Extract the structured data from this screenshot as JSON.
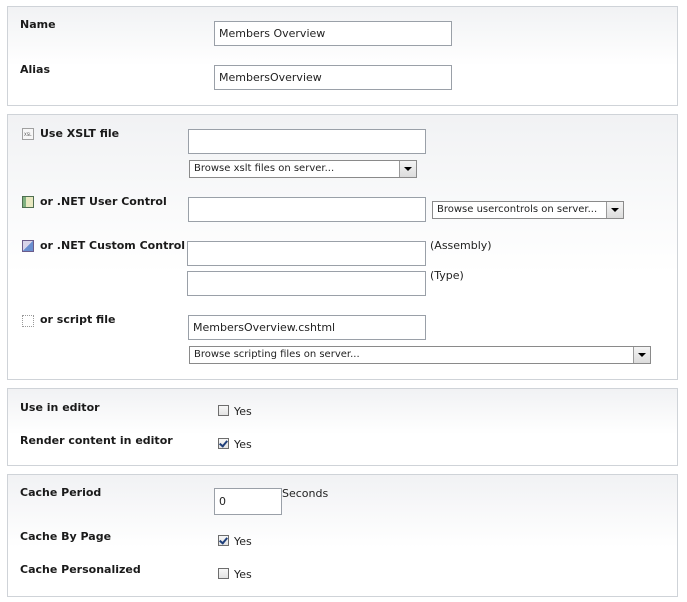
{
  "general": {
    "name_label": "Name",
    "name_value": "Members Overview",
    "alias_label": "Alias",
    "alias_value": "MembersOverview"
  },
  "source": {
    "xslt_label": "Use XSLT file",
    "xslt_value": "",
    "xslt_browse": "Browse xslt files on server...",
    "user_control_label": "or .NET User Control",
    "user_control_value": "",
    "user_control_browse": "Browse usercontrols on server...",
    "custom_control_label": "or .NET Custom Control",
    "assembly_value": "",
    "assembly_suffix": "(Assembly)",
    "type_value": "",
    "type_suffix": "(Type)",
    "script_label": "or script file",
    "script_value": "MembersOverview.cshtml",
    "script_browse": "Browse scripting files on server..."
  },
  "editor": {
    "use_in_editor_label": "Use in editor",
    "use_in_editor_checked": false,
    "use_in_editor_yes": "Yes",
    "render_content_label": "Render content in editor",
    "render_content_checked": true,
    "render_content_yes": "Yes"
  },
  "cache": {
    "period_label": "Cache Period",
    "period_value": "0",
    "period_unit": "Seconds",
    "by_page_label": "Cache By Page",
    "by_page_checked": true,
    "by_page_yes": "Yes",
    "personalized_label": "Cache Personalized",
    "personalized_checked": false,
    "personalized_yes": "Yes"
  }
}
